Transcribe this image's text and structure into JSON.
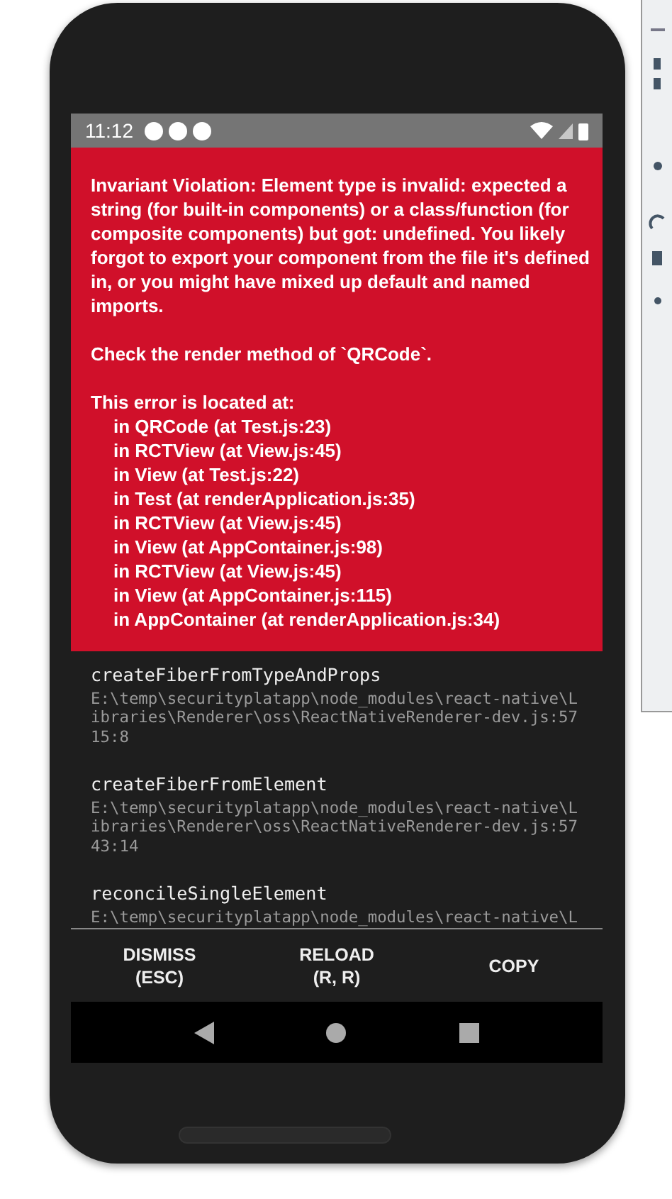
{
  "status_bar": {
    "time": "11:12",
    "notifications": [
      {
        "kind": "dot"
      },
      {
        "kind": "dot"
      },
      {
        "kind": "dot"
      }
    ]
  },
  "error": {
    "message": "Invariant Violation: Element type is invalid: expected a string (for built-in components) or a class/function (for composite components) but got: undefined. You likely forgot to export your component from the file it's defined in, or you might have mixed up default and named imports.",
    "hint": "Check the render method of `QRCode`.",
    "located_heading": "This error is located at:",
    "locations": [
      "in QRCode (at Test.js:23)",
      "in RCTView (at View.js:45)",
      "in View (at Test.js:22)",
      "in Test (at renderApplication.js:35)",
      "in RCTView (at View.js:45)",
      "in View (at AppContainer.js:98)",
      "in RCTView (at View.js:45)",
      "in View (at AppContainer.js:115)",
      "in AppContainer (at renderApplication.js:34)"
    ]
  },
  "stack": [
    {
      "function": "createFiberFromTypeAndProps",
      "path": "E:\\temp\\securityplatapp\\node_modules\\react-native\\Libraries\\Renderer\\oss\\ReactNativeRenderer-dev.js:5715:8"
    },
    {
      "function": "createFiberFromElement",
      "path": "E:\\temp\\securityplatapp\\node_modules\\react-native\\Libraries\\Renderer\\oss\\ReactNativeRenderer-dev.js:5743:14"
    },
    {
      "function": "reconcileSingleElement",
      "path": "E:\\temp\\securityplatapp\\node_modules\\react-native\\L"
    }
  ],
  "buttons": [
    {
      "label": "DISMISS",
      "shortcut": "(ESC)"
    },
    {
      "label": "RELOAD",
      "shortcut": "(R, R)"
    },
    {
      "label": "COPY"
    }
  ]
}
